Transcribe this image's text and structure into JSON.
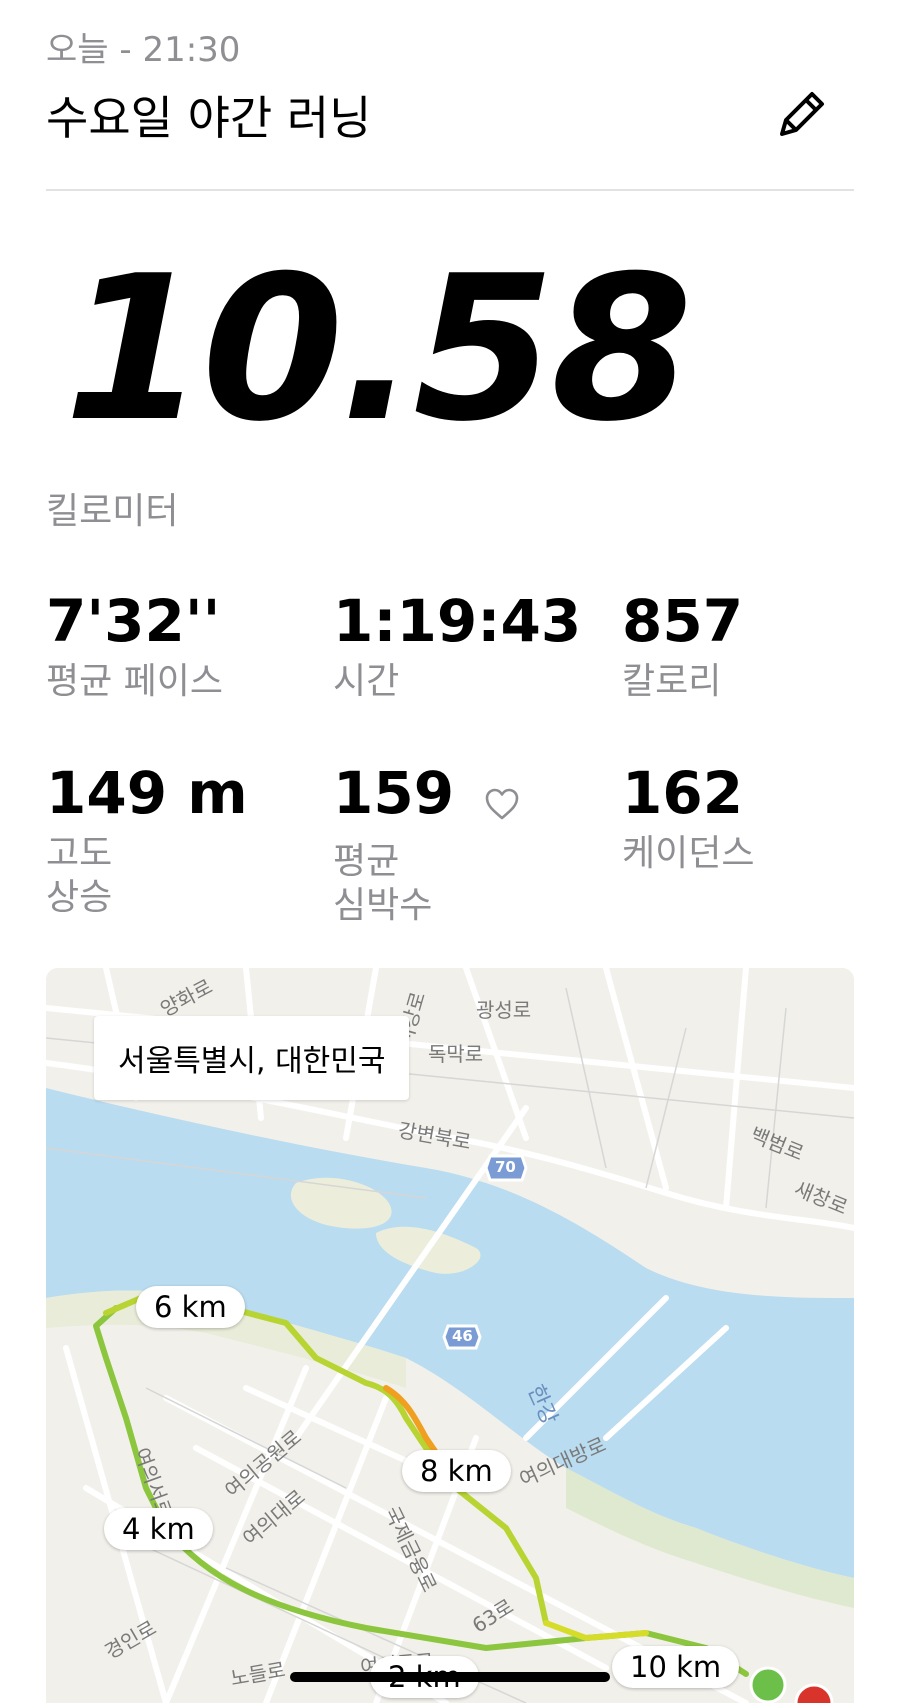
{
  "header": {
    "timestamp": "오늘 - 21:30",
    "title": "수요일 야간 러닝",
    "edit_icon": "pencil-icon"
  },
  "summary": {
    "distance": "10.58",
    "distance_unit": "킬로미터"
  },
  "stats": [
    {
      "value": "7'32''",
      "label": "평균 페이스"
    },
    {
      "value": "1:19:43",
      "label": "시간"
    },
    {
      "value": "857",
      "label": "칼로리"
    },
    {
      "value": "149 m",
      "label_line1": "고도",
      "label_line2": "상승"
    },
    {
      "value": "159",
      "label_line1": "평균",
      "label_line2": "심박수",
      "icon": "heart-icon"
    },
    {
      "value": "162",
      "label": "케이던스"
    }
  ],
  "map": {
    "location": "서울특별시, 대한민국",
    "km_markers": [
      "6 km",
      "8 km",
      "4 km",
      "10 km",
      "2 km"
    ],
    "road_labels": [
      "양화로",
      "광성로",
      "독막로",
      "강변북로",
      "백범로",
      "새창로",
      "여의공원로",
      "여의서로",
      "여의대로",
      "국제금융로",
      "여의대방로",
      "63로",
      "경인로",
      "여의동로",
      "노들로",
      "한강",
      "서강로"
    ],
    "highway_shields": [
      "70",
      "46"
    ],
    "colors": {
      "water": "#b9dcf0",
      "land": "#f2f0ea",
      "route_green": "#8cc63f",
      "route_yellow": "#d6dc2a",
      "route_orange": "#f0a020",
      "start_dot": "#6cc04a",
      "end_dot": "#d9342b"
    }
  }
}
